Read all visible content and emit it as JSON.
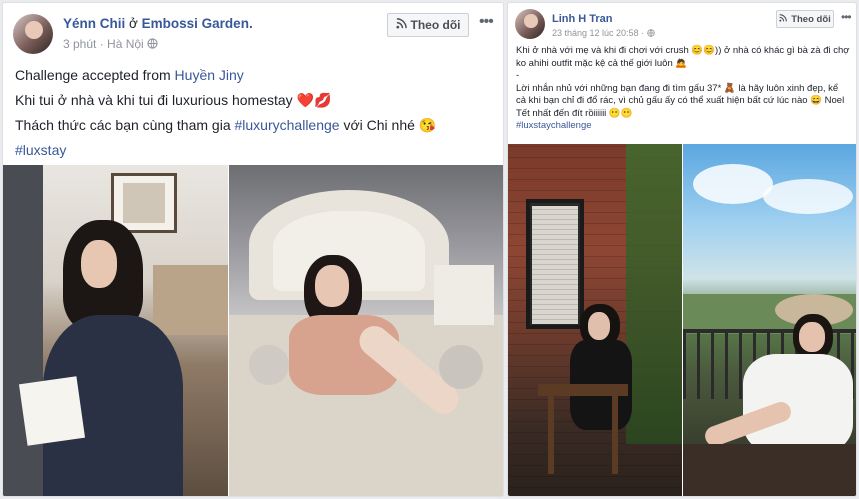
{
  "posts": [
    {
      "author": "Yénn Chii",
      "location_prefix": "ở",
      "location": "Embossi Garden.",
      "time": "3 phút",
      "place": "Hà Nội",
      "follow_label": "Theo dõi",
      "more_label": "•••",
      "text": {
        "line1_prefix": "Challenge accepted from",
        "line1_link": "Huyền Jiny",
        "line2": "Khi tui ở nhà và khi tui đi luxurious homestay",
        "line2_emoji": "❤️💋",
        "line3_prefix": "Thách thức các bạn cùng tham gia",
        "line3_link": "#luxurychallenge",
        "line3_suffix": "với Chi nhé",
        "line3_emoji": "😘",
        "line4_link": "#luxstay"
      }
    },
    {
      "author": "Linh H Tran",
      "time": "23 tháng 12 lúc 20:58",
      "follow_label": "Theo dõi",
      "more_label": "•••",
      "text": {
        "para1": "Khi ở nhà với mẹ và khi đi chơi với crush 😊😊)) ở nhà có khác gì bà zà đi chợ ko ahihi outfit mặc kệ cả thế giới luôn 🙇",
        "dash": "-",
        "para2": "Lời nhắn nhủ với những bạn đang đi tìm gấu 37* 🧸 là hãy luôn xinh đẹp, kể cả khi bạn chỉ đi đổ rác, vì chủ gấu ấy có thể xuất hiện bất cứ lúc nào 😄 Noel Tết nhất đến đít rồiiiiii 😶😶",
        "hashtag": "#luxstaychallenge"
      }
    }
  ],
  "colors": {
    "link": "#385898",
    "meta": "#90949c",
    "border": "#dddfe2",
    "background": "#e9ebee"
  },
  "icons": [
    "rss-follow-icon",
    "globe-icon",
    "more-icon"
  ]
}
